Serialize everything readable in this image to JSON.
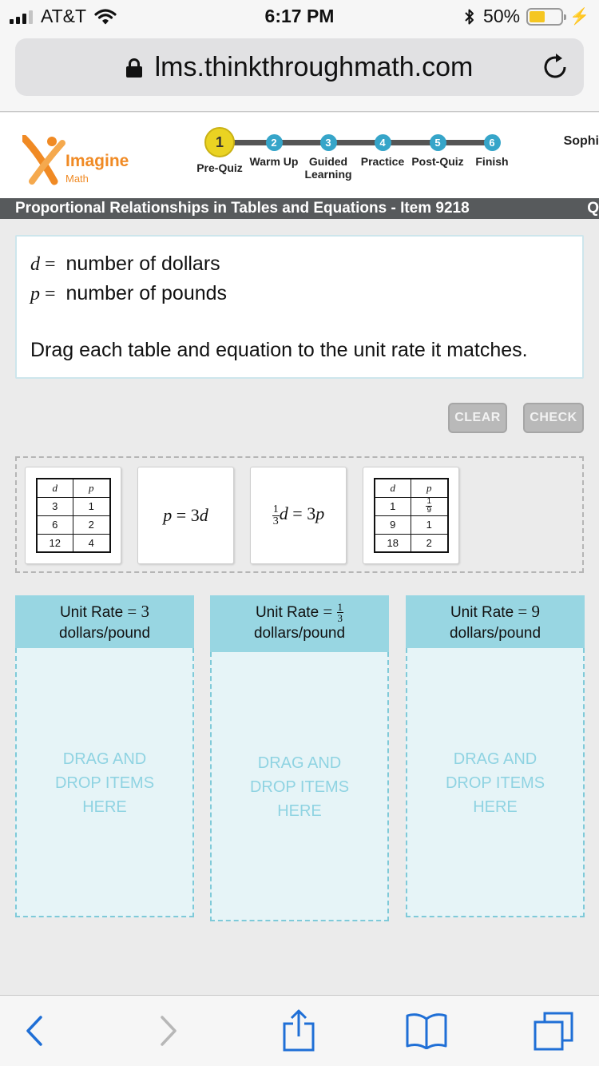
{
  "status_bar": {
    "carrier": "AT&T",
    "time": "6:17 PM",
    "battery": "50%",
    "battery_level": 0.5,
    "icons": [
      "signal-icon",
      "wifi-icon",
      "bluetooth-icon",
      "battery-icon",
      "charging-icon"
    ]
  },
  "browser": {
    "url": "lms.thinkthroughmath.com",
    "icons": [
      "lock-icon",
      "reload-icon"
    ]
  },
  "header": {
    "logo_line1": "Imagine",
    "logo_line2": "Math",
    "user_name": "Sophi",
    "steps": [
      {
        "num": "1",
        "label": "Pre-Quiz",
        "current": true
      },
      {
        "num": "2",
        "label": "Warm Up"
      },
      {
        "num": "3",
        "label_line1": "Guided",
        "label_line2": "Learning"
      },
      {
        "num": "4",
        "label": "Practice"
      },
      {
        "num": "5",
        "label": "Post-Quiz"
      },
      {
        "num": "6",
        "label": "Finish"
      }
    ]
  },
  "title_bar": {
    "title": "Proportional Relationships in Tables and Equations - Item 9218",
    "right_text": "Q"
  },
  "question": {
    "var1_symbol": "d",
    "var1_eq": "=",
    "var1_desc": "number of dollars",
    "var2_symbol": "p",
    "var2_eq": "=",
    "var2_desc": "number of pounds",
    "instruction": "Drag each table and equation to the unit rate it matches."
  },
  "buttons": {
    "clear": "CLEAR",
    "check": "CHECK"
  },
  "tiles": {
    "table1": {
      "headers": [
        "d",
        "p"
      ],
      "rows": [
        [
          "3",
          "1"
        ],
        [
          "6",
          "2"
        ],
        [
          "12",
          "4"
        ]
      ]
    },
    "equation1": {
      "lhs": "p",
      "rhs_coef": "3",
      "rhs_var": "d"
    },
    "equation2": {
      "frac_num": "1",
      "frac_den": "3",
      "lhs_var": "d",
      "rhs_coef": "3",
      "rhs_var": "p"
    },
    "table2": {
      "headers": [
        "d",
        "p"
      ],
      "row1_d": "1",
      "row1_p_num": "1",
      "row1_p_den": "9",
      "rows": [
        [
          "9",
          "1"
        ],
        [
          "18",
          "2"
        ]
      ]
    }
  },
  "drop_zones": [
    {
      "prefix": "Unit Rate",
      "eq": "=",
      "value": "3",
      "unit": "dollars/pound",
      "hint_line1": "DRAG AND",
      "hint_line2": "DROP ITEMS",
      "hint_line3": "HERE"
    },
    {
      "prefix": "Unit Rate",
      "eq": "=",
      "value_num": "1",
      "value_den": "3",
      "unit": "dollars/pound",
      "hint_line1": "DRAG AND",
      "hint_line2": "DROP ITEMS",
      "hint_line3": "HERE"
    },
    {
      "prefix": "Unit Rate",
      "eq": "=",
      "value": "9",
      "unit": "dollars/pound",
      "hint_line1": "DRAG AND",
      "hint_line2": "DROP ITEMS",
      "hint_line3": "HERE"
    }
  ],
  "toolbar": {
    "icons": [
      "back-arrow-icon",
      "forward-arrow-icon",
      "share-icon",
      "bookmarks-icon",
      "tabs-icon"
    ]
  },
  "colors": {
    "accent_blue": "#36a5c9",
    "current_step_yellow": "#ead322",
    "zone_header": "#98d6e2",
    "zone_body": "#e6f4f7",
    "title_bar": "#575a5c",
    "logo_orange": "#f08a24",
    "ios_blue": "#1f6fd6"
  }
}
